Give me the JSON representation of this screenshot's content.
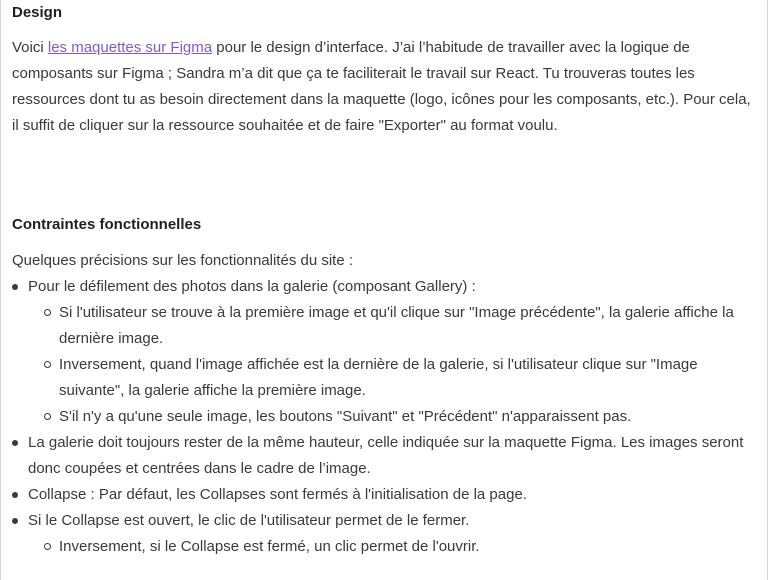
{
  "design": {
    "heading": "Design",
    "text_before_link": "Voici ",
    "link_text": "les maquettes sur Figma",
    "text_after_link": " pour le design d’interface. J’ai l’habitude de travailler avec la logique de composants sur Figma ; Sandra m’a dit que ça te faciliterait le travail sur React. Tu trouveras toutes les ressources dont tu as besoin directement dans la maquette (logo, icônes pour les composants, etc.). Pour cela, il suffit de cliquer sur la ressource souhaitée et de faire \"Exporter\" au format voulu."
  },
  "contraintes": {
    "heading": "Contraintes fonctionnelles",
    "intro": "Quelques précisions sur les fonctionnalités du site :",
    "items": [
      {
        "text": "Pour le défilement des photos dans la galerie (composant Gallery) :",
        "subitems": [
          "Si l'utilisateur se trouve à la première image et qu'il clique sur \"Image précédente\", la galerie affiche la dernière image.",
          "Inversement, quand l'image affichée est la dernière de la galerie, si l'utilisateur clique sur \"Image suivante\", la galerie affiche la première image.",
          "S'il n'y a qu'une seule image, les boutons \"Suivant\" et \"Précédent\" n'apparaissent pas."
        ]
      },
      {
        "text": "La galerie doit toujours rester de la même hauteur, celle indiquée sur la maquette Figma. Les images seront donc coupées et centrées dans le cadre de l’image."
      },
      {
        "text": "Collapse : Par défaut, les Collapses sont fermés à l'initialisation de la page."
      },
      {
        "text": "Si le Collapse est ouvert, le clic de l'utilisateur permet de le fermer.",
        "subitems": [
          "Inversement, si le Collapse est fermé, un clic permet de l'ouvrir."
        ]
      }
    ]
  }
}
